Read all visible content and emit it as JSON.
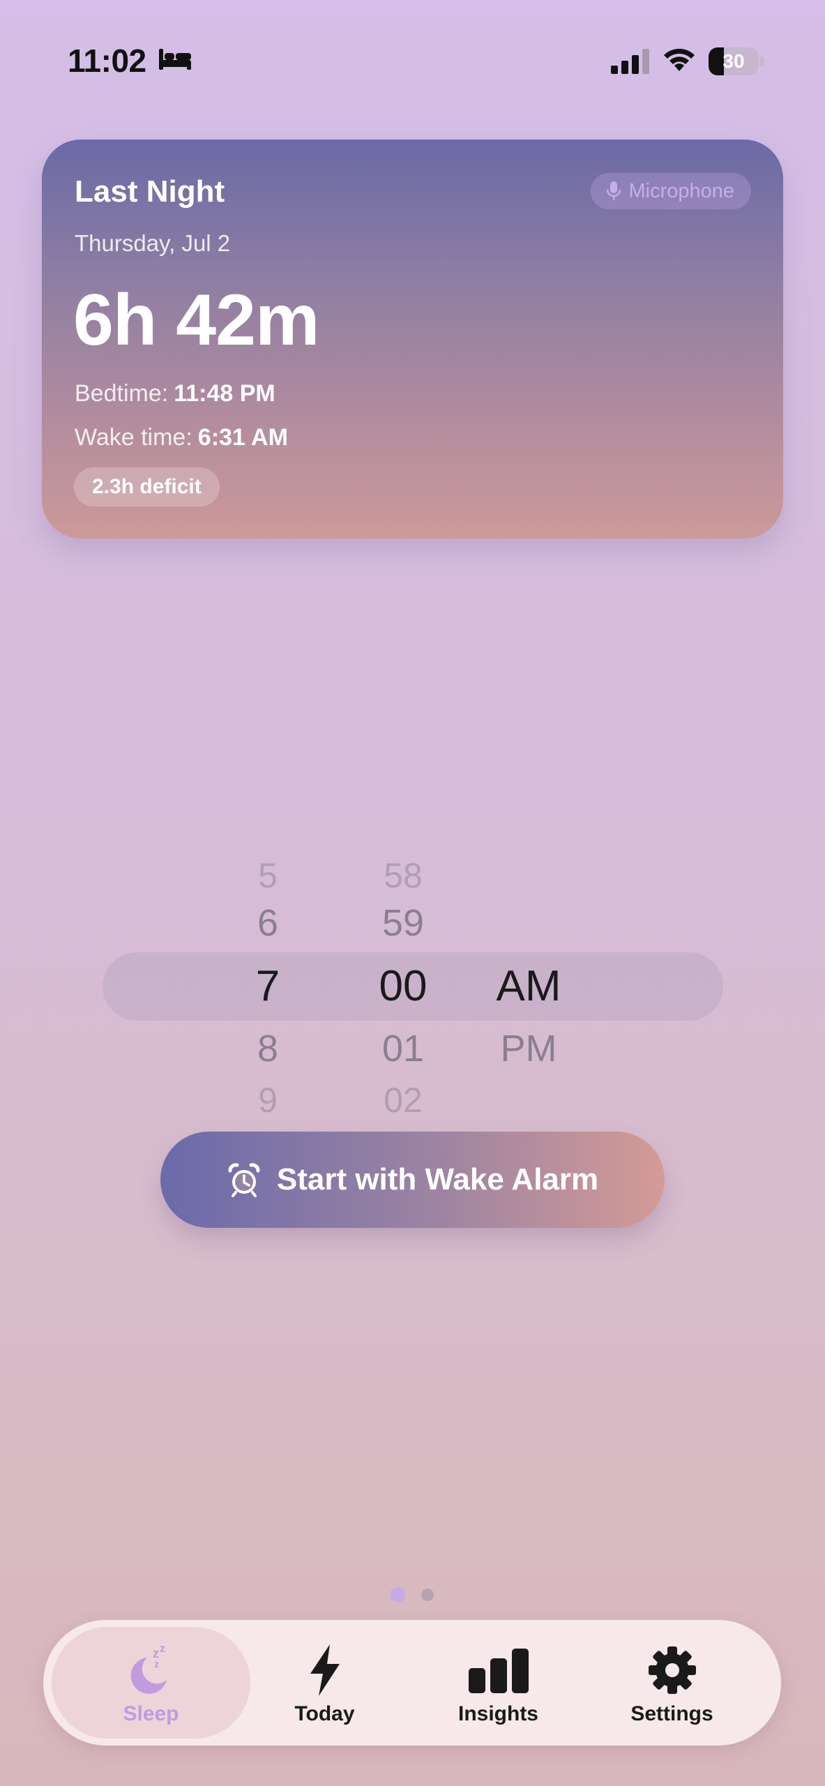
{
  "status_bar": {
    "time": "11:02",
    "battery": "30",
    "battery_fraction": 0.3
  },
  "last_night": {
    "title": "Last Night",
    "source_chip": "Microphone",
    "date": "Thursday, Jul 2",
    "duration": "6h 42m",
    "bedtime_label": "Bedtime:",
    "bedtime_value": "11:48 PM",
    "wake_label": "Wake time:",
    "wake_value": "6:31 AM",
    "deficit_badge": "2.3h deficit"
  },
  "alarm_picker": {
    "hours": {
      "above2": "5",
      "above1": "6",
      "selected": "7",
      "below1": "8",
      "below2": "9"
    },
    "minutes": {
      "above2": "58",
      "above1": "59",
      "selected": "00",
      "below1": "01",
      "below2": "02"
    },
    "period": {
      "selected": "AM",
      "below1": "PM"
    }
  },
  "start_button": {
    "label": "Start with Wake Alarm"
  },
  "pager": {
    "pages": 2,
    "current": 1
  },
  "tabs": [
    {
      "label": "Sleep",
      "icon": "moon-zzz-icon",
      "active": true
    },
    {
      "label": "Today",
      "icon": "bolt-icon",
      "active": false
    },
    {
      "label": "Insights",
      "icon": "bar-chart-icon",
      "active": false
    },
    {
      "label": "Settings",
      "icon": "gear-icon",
      "active": false
    }
  ],
  "colors": {
    "accent": "#c29adf",
    "card_top": "#6a6aa6",
    "card_bottom": "#cc9a98"
  }
}
